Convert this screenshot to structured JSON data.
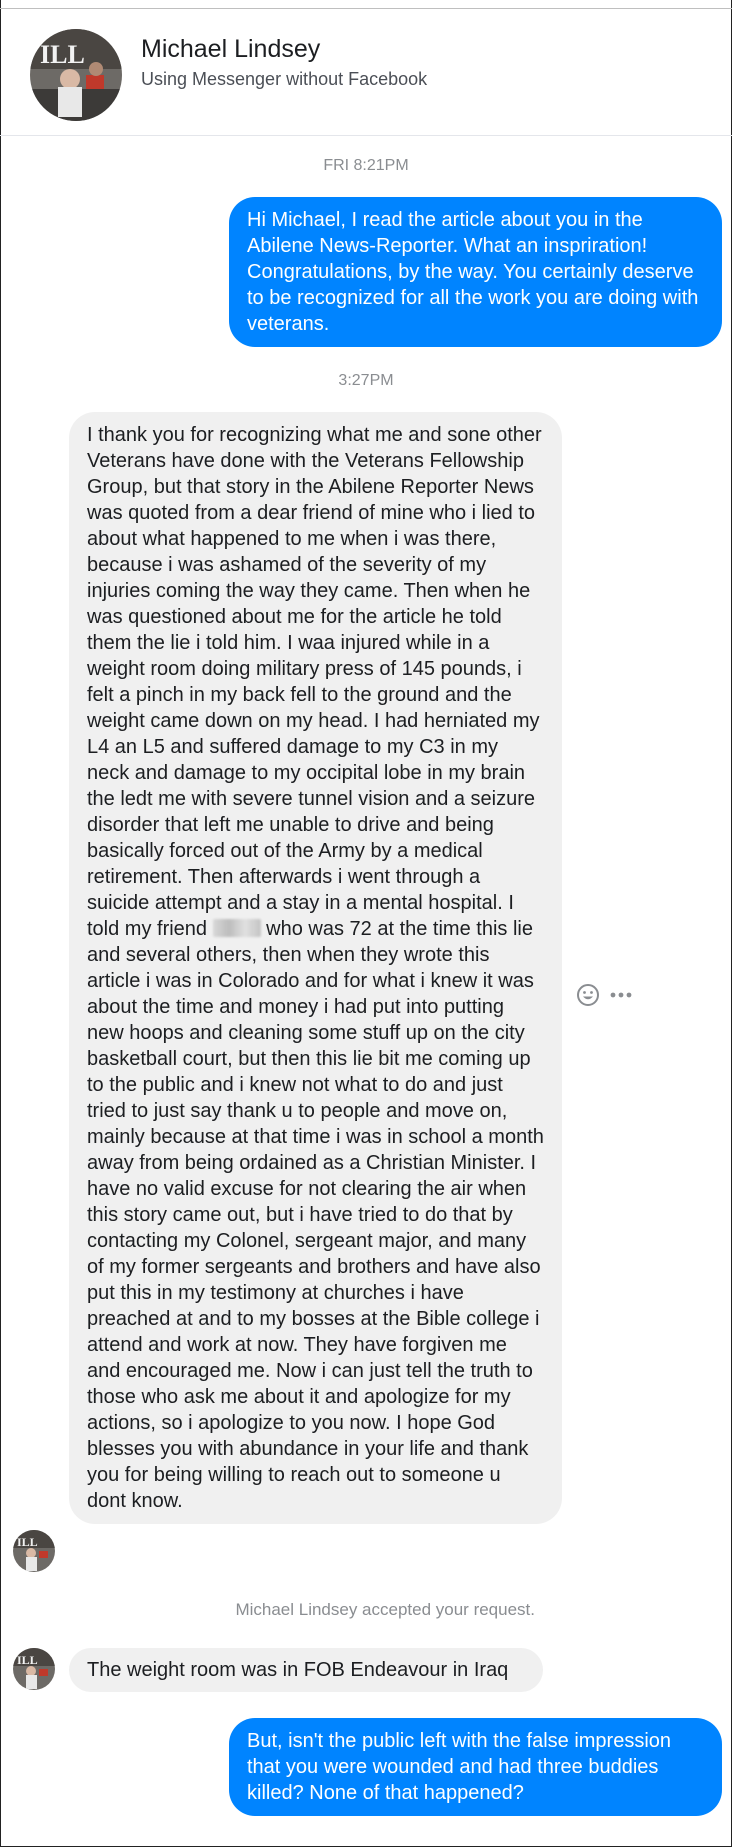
{
  "header": {
    "contact_name": "Michael Lindsey",
    "status": "Using Messenger without Facebook"
  },
  "thread": {
    "timestamp_1": "FRI 8:21PM",
    "outgoing_1": "Hi Michael, I read the article about you in the Abilene News-Reporter.  What an inspriration!  Congratulations, by the way.  You certainly deserve to be recognized for all the work you are doing with veterans.",
    "timestamp_2": "3:27PM",
    "incoming_1_part1": "I thank you for recognizing what me and sone other Veterans have done with the Veterans Fellowship Group,  but that story in the Abilene Reporter News was quoted from a dear friend of mine who i lied to about what happened to me when i was there, because i was ashamed of the severity of my injuries coming the way they came. Then when he was questioned about me for the article he told them the lie i told him. I waa injured while in a weight room doing military press of 145 pounds, i felt a pinch in my back fell to the ground and the weight came down on my head. I had herniated my L4 an L5 and suffered damage to my C3 in my neck and damage to my occipital lobe in my brain the ledt me with severe tunnel vision and a seizure disorder that left me unable to drive and being basically forced out of the Army by a medical retirement.  Then afterwards i went through a suicide attempt and a stay in a mental hospital.  I told my friend ",
    "incoming_1_part2": " who was 72 at the time this lie and several others, then when they wrote this article i was in Colorado and for what i knew it was about the time and money i had put into putting new hoops and cleaning some stuff up on the city basketball court, but then this lie bit me coming up to the public and i knew not what to do and just tried to just say thank u to people and move on, mainly because at that time i was in school a month away from being ordained as a Christian Minister.  I have no valid excuse for not clearing the air when this story came out, but i have tried to do that by contacting my Colonel, sergeant major, and many of my former sergeants and brothers and have also put this in my testimony at churches i have preached at and to my bosses at the Bible college i attend and work at now. They have forgiven me and encouraged me. Now i can just tell the truth to those who ask me about it and apologize for my actions, so i apologize to you now. I hope God blesses you with abundance in your life and thank you for being willing to reach out to someone u dont know.",
    "system_notice": "Michael Lindsey accepted your request.",
    "incoming_2": "The weight room was in FOB Endeavour  in Iraq",
    "outgoing_2": "But, isn't the public left with the false impression that you were wounded and had three buddies killed?  None of that happened?"
  },
  "icons": {
    "react": "smiley-face-icon",
    "more": "more-options-icon",
    "avatar": "profile-photo"
  },
  "colors": {
    "outgoing_bubble": "#0084ff",
    "incoming_bubble": "#f0f0f0",
    "timestamp": "#8a8d91"
  }
}
